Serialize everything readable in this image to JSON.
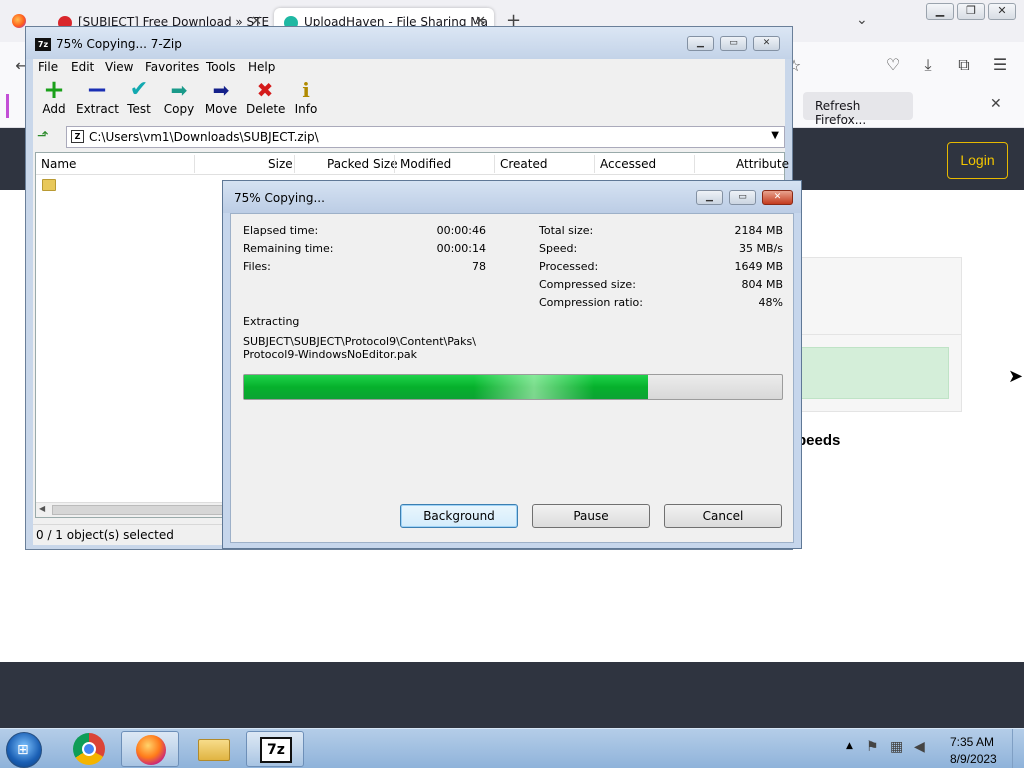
{
  "firefox": {
    "tabs": [
      {
        "label": "[SUBJECT] Free Download » STE"
      },
      {
        "label": "UploadHaven - File Sharing Ma"
      }
    ],
    "new_tab_symbol": "+",
    "notification_button": "Refresh Firefox...",
    "site_login": "Login",
    "site_text_fragment": "peeds"
  },
  "zip_window": {
    "title": "75% Copying... 7-Zip",
    "menu": [
      "File",
      "Edit",
      "View",
      "Favorites",
      "Tools",
      "Help"
    ],
    "toolbar": [
      {
        "label": "Add",
        "icon": "add-icon"
      },
      {
        "label": "Extract",
        "icon": "extract-icon"
      },
      {
        "label": "Test",
        "icon": "test-icon"
      },
      {
        "label": "Copy",
        "icon": "copy-icon"
      },
      {
        "label": "Move",
        "icon": "move-icon"
      },
      {
        "label": "Delete",
        "icon": "delete-icon"
      },
      {
        "label": "Info",
        "icon": "info-icon"
      }
    ],
    "address": "C:\\Users\\vm1\\Downloads\\SUBJECT.zip\\",
    "columns": [
      "Name",
      "Size",
      "Packed Size",
      "Modified",
      "Created",
      "Accessed",
      "Attribute"
    ],
    "status": "0 / 1 object(s) selected"
  },
  "dialog": {
    "title": "75% Copying...",
    "left_stats": [
      {
        "label": "Elapsed time:",
        "value": "00:00:46"
      },
      {
        "label": "Remaining time:",
        "value": "00:00:14"
      },
      {
        "label": "Files:",
        "value": "78"
      }
    ],
    "right_stats": [
      {
        "label": "Total size:",
        "value": "2184 MB"
      },
      {
        "label": "Speed:",
        "value": "35 MB/s"
      },
      {
        "label": "Processed:",
        "value": "1649 MB"
      },
      {
        "label": "Compressed size:",
        "value": "804 MB"
      },
      {
        "label": "Compression ratio:",
        "value": "48%"
      }
    ],
    "action": "Extracting",
    "path_line1": "SUBJECT\\SUBJECT\\Protocol9\\Content\\Paks\\",
    "path_line2": "Protocol9-WindowsNoEditor.pak",
    "progress_percent": 75,
    "buttons": {
      "background": "Background",
      "pause": "Pause",
      "cancel": "Cancel"
    }
  },
  "taskbar": {
    "time": "7:35 AM",
    "date": "8/9/2023"
  },
  "colors": {
    "progress": "#06b12c",
    "site_header": "#2f3440",
    "login_accent": "#f2c500"
  }
}
